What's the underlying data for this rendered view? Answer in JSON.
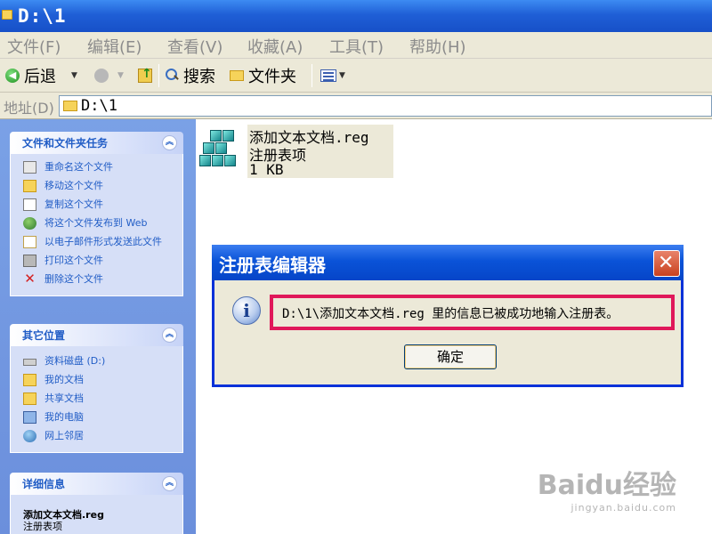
{
  "window": {
    "title": "D:\\1"
  },
  "menu": {
    "items": [
      "文件(F)",
      "编辑(E)",
      "查看(V)",
      "收藏(A)",
      "工具(T)",
      "帮助(H)"
    ]
  },
  "toolbar": {
    "back_label": "后退",
    "search_label": "搜索",
    "folders_label": "文件夹"
  },
  "address": {
    "label": "地址(D)",
    "value": "D:\\1"
  },
  "task_pane": {
    "file_tasks": {
      "title": "文件和文件夹任务",
      "items": [
        {
          "label": "重命名这个文件",
          "icon": "rename-icon"
        },
        {
          "label": "移动这个文件",
          "icon": "move-icon"
        },
        {
          "label": "复制这个文件",
          "icon": "copy-icon"
        },
        {
          "label": "将这个文件发布到 Web",
          "icon": "publish-web-icon"
        },
        {
          "label": "以电子邮件形式发送此文件",
          "icon": "email-icon"
        },
        {
          "label": "打印这个文件",
          "icon": "print-icon"
        },
        {
          "label": "删除这个文件",
          "icon": "delete-icon"
        }
      ]
    },
    "other_places": {
      "title": "其它位置",
      "items": [
        {
          "label": "资料磁盘 (D:)",
          "icon": "drive-icon"
        },
        {
          "label": "我的文档",
          "icon": "my-documents-icon"
        },
        {
          "label": "共享文档",
          "icon": "shared-documents-icon"
        },
        {
          "label": "我的电脑",
          "icon": "my-computer-icon"
        },
        {
          "label": "网上邻居",
          "icon": "network-places-icon"
        }
      ]
    },
    "details": {
      "title": "详细信息",
      "name": "添加文本文档.reg",
      "type": "注册表项"
    }
  },
  "file": {
    "name": "添加文本文档.reg",
    "type": "注册表项",
    "size": "1 KB"
  },
  "dialog": {
    "title": "注册表编辑器",
    "message": "D:\\1\\添加文本文档.reg 里的信息已被成功地输入注册表。",
    "ok_label": "确定"
  },
  "watermark": {
    "logo": "Baidu经验",
    "sub": "jingyan.baidu.com"
  },
  "colors": {
    "title_bar": "#1f5fd6",
    "task_pane_bg": "#6b8fdc",
    "highlight_border": "#e0185a",
    "link_blue": "#215dc6"
  }
}
